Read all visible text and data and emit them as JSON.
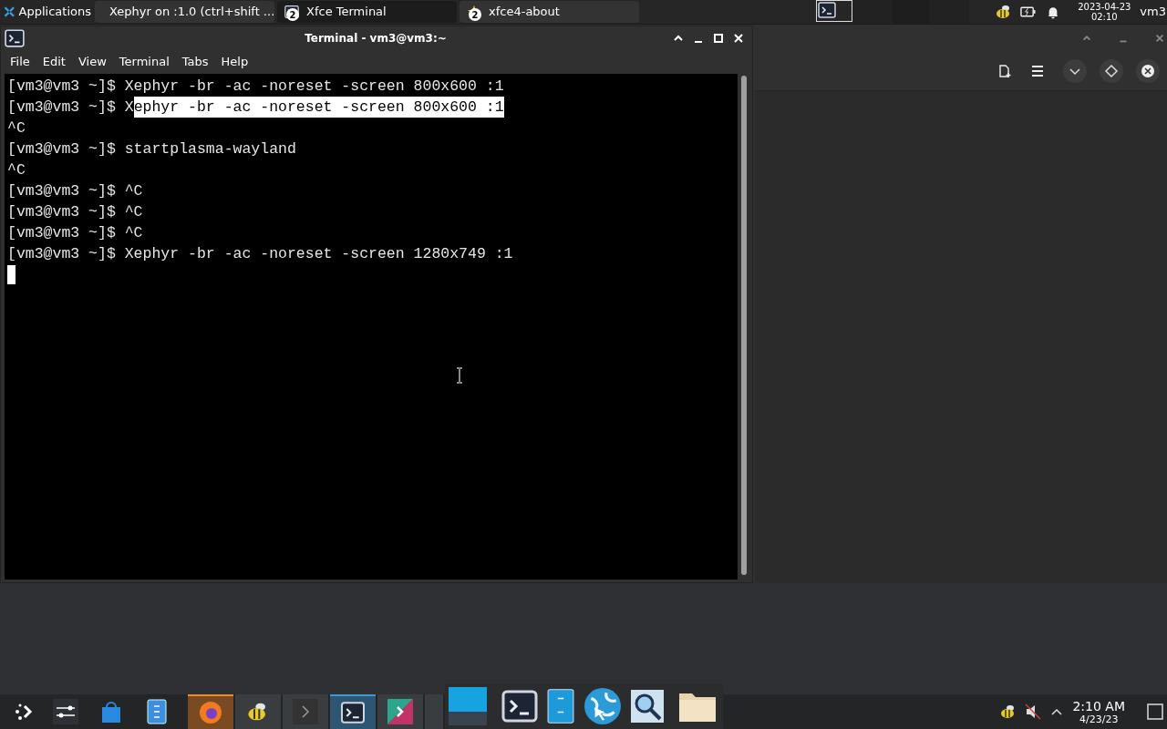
{
  "top_panel": {
    "menu_label": "Applications",
    "tasks": [
      {
        "kind": "window",
        "label": "Xephyr on :1.0 (ctrl+shift ...",
        "selected": false
      },
      {
        "kind": "terminal",
        "label": "Xfce Terminal",
        "badge": "2",
        "selected": true
      },
      {
        "kind": "star",
        "label": "xfce4-about",
        "badge": "2",
        "selected": false
      }
    ],
    "clock_date": "2023-04-23",
    "clock_time": "02:10",
    "user": "vm3"
  },
  "terminal": {
    "title": "Terminal - vm3@vm3:~",
    "menu": [
      "File",
      "Edit",
      "View",
      "Terminal",
      "Tabs",
      "Help"
    ],
    "lines": [
      [
        {
          "text": "[vm3@vm3 ~]$ Xephyr -br -ac -noreset -screen 800x600 :1",
          "selected": false
        }
      ],
      [
        {
          "text": "[vm3@vm3 ~]$ X",
          "selected": false
        },
        {
          "text": "ephyr -br -ac -noreset -screen 800x600 :1",
          "selected": true
        }
      ],
      [
        {
          "text": "^C",
          "selected": false
        }
      ],
      [
        {
          "text": "[vm3@vm3 ~]$ startplasma-wayland",
          "selected": false
        }
      ],
      [
        {
          "text": "^C",
          "selected": false
        }
      ],
      [
        {
          "text": "[vm3@vm3 ~]$ ^C",
          "selected": false
        }
      ],
      [
        {
          "text": "[vm3@vm3 ~]$ ^C",
          "selected": false
        }
      ],
      [
        {
          "text": "[vm3@vm3 ~]$ ^C",
          "selected": false
        }
      ],
      [
        {
          "text": "[vm3@vm3 ~]$ Xephyr -br -ac -noreset -screen 1280x749 :1",
          "selected": false
        }
      ]
    ]
  },
  "taskbar": {
    "clock_time": "2:10 AM",
    "clock_date": "4/23/23"
  }
}
